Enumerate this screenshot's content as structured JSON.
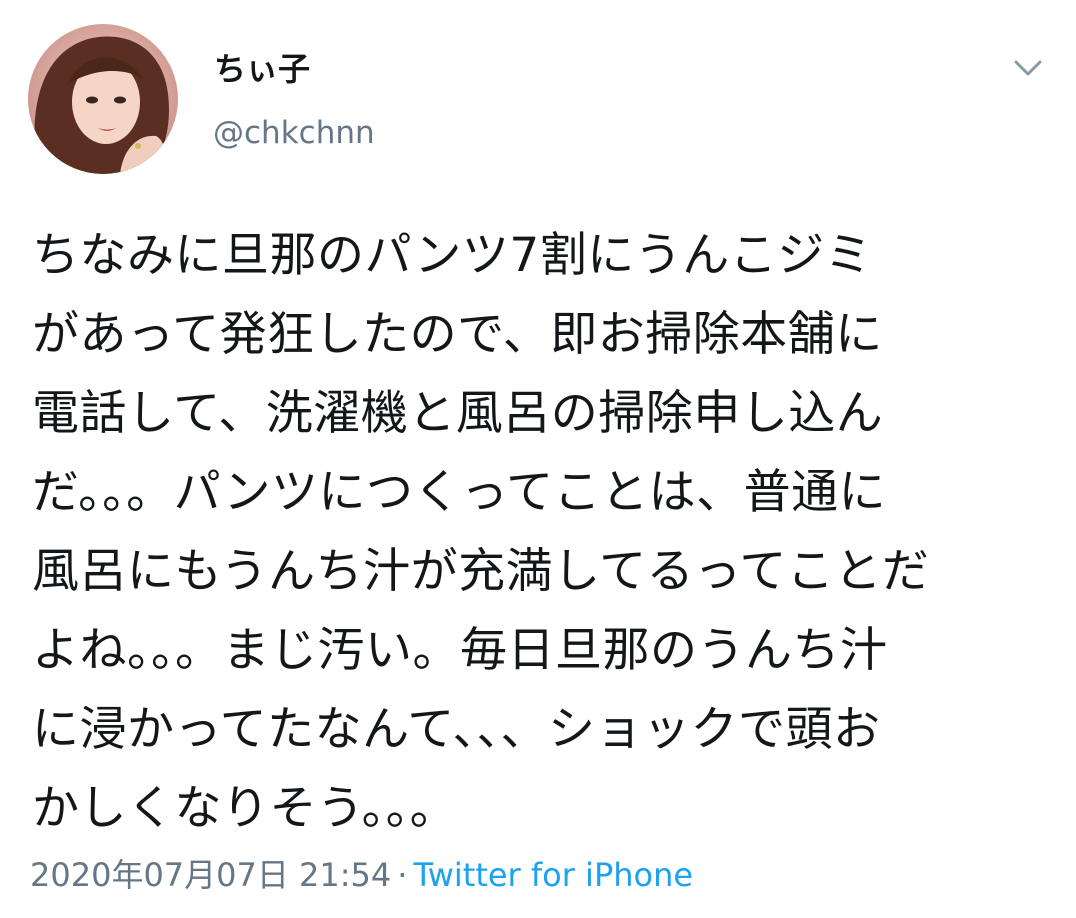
{
  "user": {
    "display_name": "ちぃ子",
    "handle": "@chkchnn",
    "avatar_icon": "profile-photo"
  },
  "menu": {
    "icon": "chevron-down-icon"
  },
  "tweet": {
    "text": "ちなみに旦那のパンツ7割にうんこジミ\nがあって発狂したので、即お掃除本舗に\n電話して、洗濯機と風呂の掃除申し込ん\nだ。。。パンツにつくってことは、普通に\n風呂にもうんち汁が充満してるってことだ\nよね。。。まじ汚い。毎日旦那のうんち汁\nに浸かってたなんて、、、ショックで頭お\nかしくなりそう。。。"
  },
  "meta": {
    "timestamp": "2020年07月07日 21:54",
    "separator": "·",
    "source": "Twitter for iPhone"
  },
  "colors": {
    "text": "#14171a",
    "secondary": "#657786",
    "link": "#1da1f2"
  }
}
